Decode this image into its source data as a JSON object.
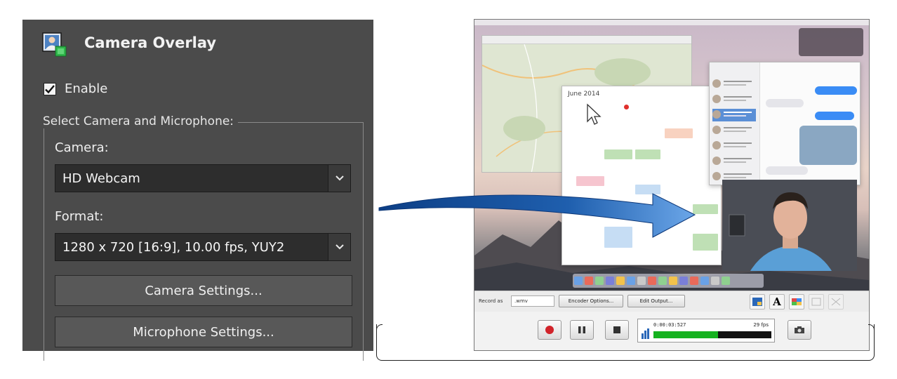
{
  "camera_overlay": {
    "title": "Camera Overlay",
    "icon": "webcam-overlay-icon",
    "enable": {
      "label": "Enable",
      "checked": true
    },
    "group_legend": "Select Camera and Microphone:",
    "camera": {
      "label": "Camera:",
      "value": "HD Webcam"
    },
    "format": {
      "label": "Format:",
      "value": "1280 x 720 [16:9], 10.00 fps, YUY2"
    },
    "camera_settings_button": "Camera Settings...",
    "microphone_settings_button": "Microphone Settings..."
  },
  "preview": {
    "calendar_title": "June 2014",
    "recorder": {
      "record_as_label": "Record as",
      "format_value": ".wmv",
      "encoder_options_button": "Encoder Options...",
      "edit_output_button": "Edit Output...",
      "elapsed_time": "0:00:03:527",
      "fps": "29 fps",
      "level": 0.55
    }
  },
  "colors": {
    "panel_bg": "#4b4b4b",
    "arrow_blue": "#1f5fae",
    "record_red": "#d1232a",
    "meter_green": "#15b21f"
  }
}
